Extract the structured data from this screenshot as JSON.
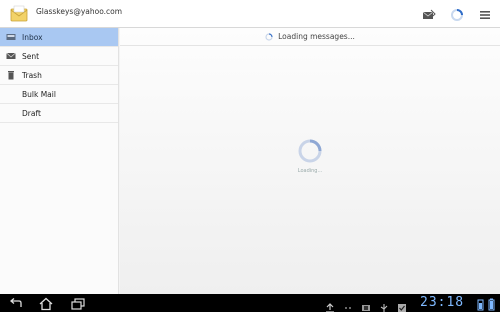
{
  "account": {
    "email": "Glasskeys@yahoo.com"
  },
  "sidebar": {
    "items": [
      {
        "label": "Inbox",
        "icon": "inbox-icon",
        "active": true
      },
      {
        "label": "Sent",
        "icon": "sent-icon"
      },
      {
        "label": "Trash",
        "icon": "trash-icon"
      },
      {
        "label": "Bulk Mail"
      },
      {
        "label": "Draft"
      }
    ]
  },
  "main": {
    "status": "Loading messages...",
    "loading_text": "Loading..."
  },
  "statusbar": {
    "time": "23:18"
  },
  "colors": {
    "accent": "#a9c8f2",
    "clock": "#7fb9ff"
  }
}
